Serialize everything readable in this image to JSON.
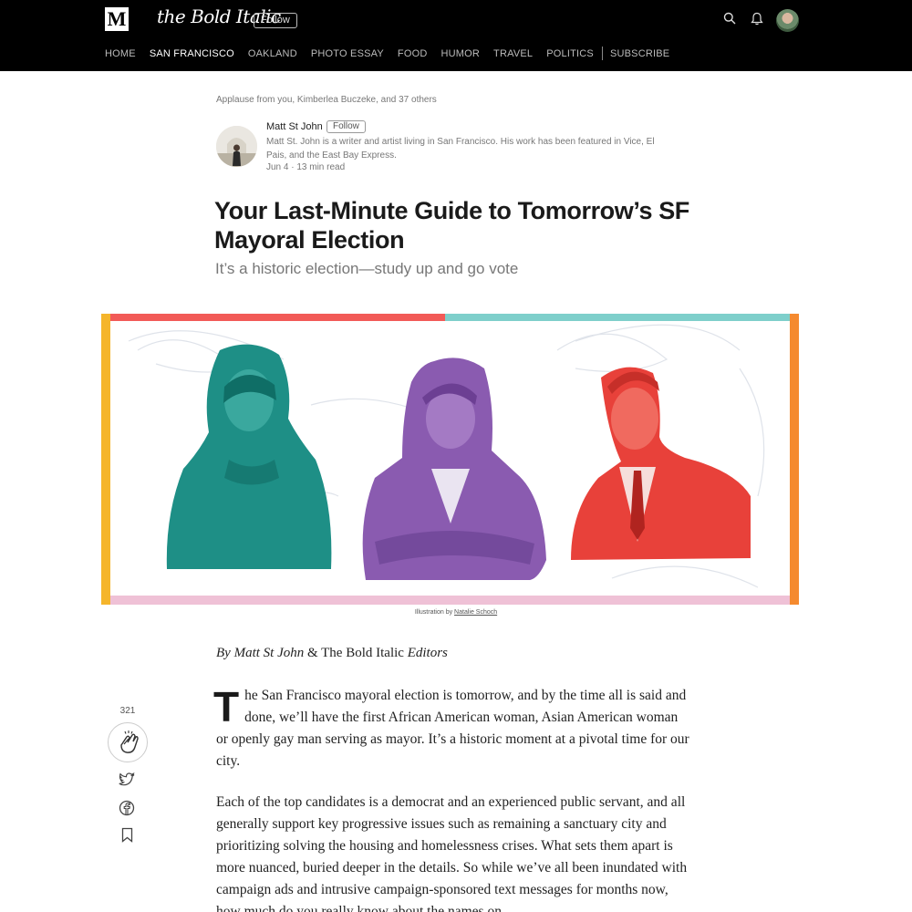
{
  "header": {
    "logo_letter": "M",
    "publication": "the Bold Italic",
    "follow_label": "Follow",
    "nav": [
      "HOME",
      "SAN FRANCISCO",
      "OAKLAND",
      "PHOTO ESSAY",
      "FOOD",
      "HUMOR",
      "TRAVEL",
      "POLITICS"
    ],
    "nav_active": "SAN FRANCISCO",
    "subscribe_label": "SUBSCRIBE"
  },
  "article": {
    "applause": "Applause from you, Kimberlea Buczeke, and 37 others",
    "author": {
      "name": "Matt St John",
      "follow_label": "Follow",
      "bio": "Matt St. John is a writer and artist living in San Francisco. His work has been featured in Vice, El Pais, and the East Bay Express.",
      "date": "Jun 4 · 13 min read"
    },
    "title": "Your Last-Minute Guide to Tomorrow’s SF Mayoral Election",
    "subtitle": "It’s a historic election—study up and go vote",
    "caption_prefix": "Illustration by",
    "caption_credit": "Natalie Schoch",
    "byline_author": "By Matt St John",
    "byline_amp": "&",
    "byline_pub": "The Bold Italic",
    "byline_suffix": "Editors",
    "dropcap": "T",
    "p1_rest": "he San Francisco mayoral election is tomorrow, and by the time all is said and done, we’ll have the first African American woman, Asian American woman or openly gay man serving as mayor. It’s a historic moment at a pivotal time for our city.",
    "p2": "Each of the top candidates is a democrat and an experienced public servant, and all generally support key progressive issues such as remaining a sanctuary city and prioritizing solving the housing and homelessness crises. What sets them apart is more nuanced, buried deeper in the details. So while we’ve all been inundated with campaign ads and intrusive campaign-sponsored text messages for months now, how much do you really know about the names on"
  },
  "rail": {
    "clap_count": "321"
  },
  "colors": {
    "teal": "#1e8f86",
    "purple": "#8a5bb0",
    "red": "#e8413a",
    "top_bar_left": "#f25a57",
    "top_bar_right": "#7ecfcb",
    "left_bar": "#f5b52b",
    "right_bar": "#f58a2f",
    "bottom_bar": "#efc1d6"
  }
}
